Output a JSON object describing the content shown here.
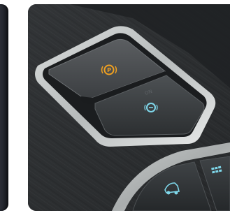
{
  "photo": {
    "subject": "car-center-console-brake-buttons",
    "icons": [
      {
        "name": "parking-brake-icon",
        "color": "#f0a020"
      },
      {
        "name": "auto-hold-icon",
        "color": "#7fd7ea"
      },
      {
        "name": "drive-mode-icon",
        "color": "#7fd7ea"
      },
      {
        "name": "eco-icon",
        "color": "#7fd7ea"
      }
    ]
  }
}
